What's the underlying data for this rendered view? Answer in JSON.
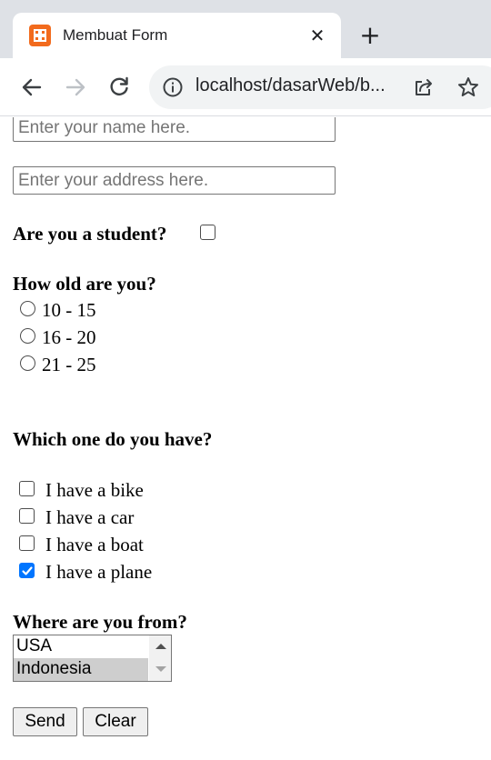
{
  "browser": {
    "tab_title": "Membuat Form",
    "tab_close_glyph": "✕",
    "new_tab_glyph": "+",
    "url": "localhost/dasarWeb/b...",
    "icons": [
      "app-logo-icon",
      "close-icon",
      "plus-icon",
      "back-arrow-icon",
      "forward-arrow-icon",
      "reload-icon",
      "info-icon",
      "share-icon",
      "star-icon"
    ],
    "accent_color": "#f26b1d"
  },
  "form": {
    "name_placeholder": "Enter your name here.",
    "address_placeholder": "Enter your address here.",
    "student_question": "Are you a student?",
    "student_checked": false,
    "age_question": "How old are you?",
    "age_options": [
      "10 - 15",
      "16 - 20",
      "21 - 25"
    ],
    "have_question": "Which one do you have?",
    "have_options": [
      {
        "label": "I have a bike",
        "checked": false
      },
      {
        "label": "I have a car",
        "checked": false
      },
      {
        "label": "I have a boat",
        "checked": false
      },
      {
        "label": "I have a plane",
        "checked": true
      }
    ],
    "from_question": "Where are you from?",
    "country_options": [
      "USA",
      "Indonesia"
    ],
    "country_selected": "Indonesia",
    "send_label": "Send",
    "clear_label": "Clear",
    "checkbox_checked_color": "#0075ff"
  }
}
